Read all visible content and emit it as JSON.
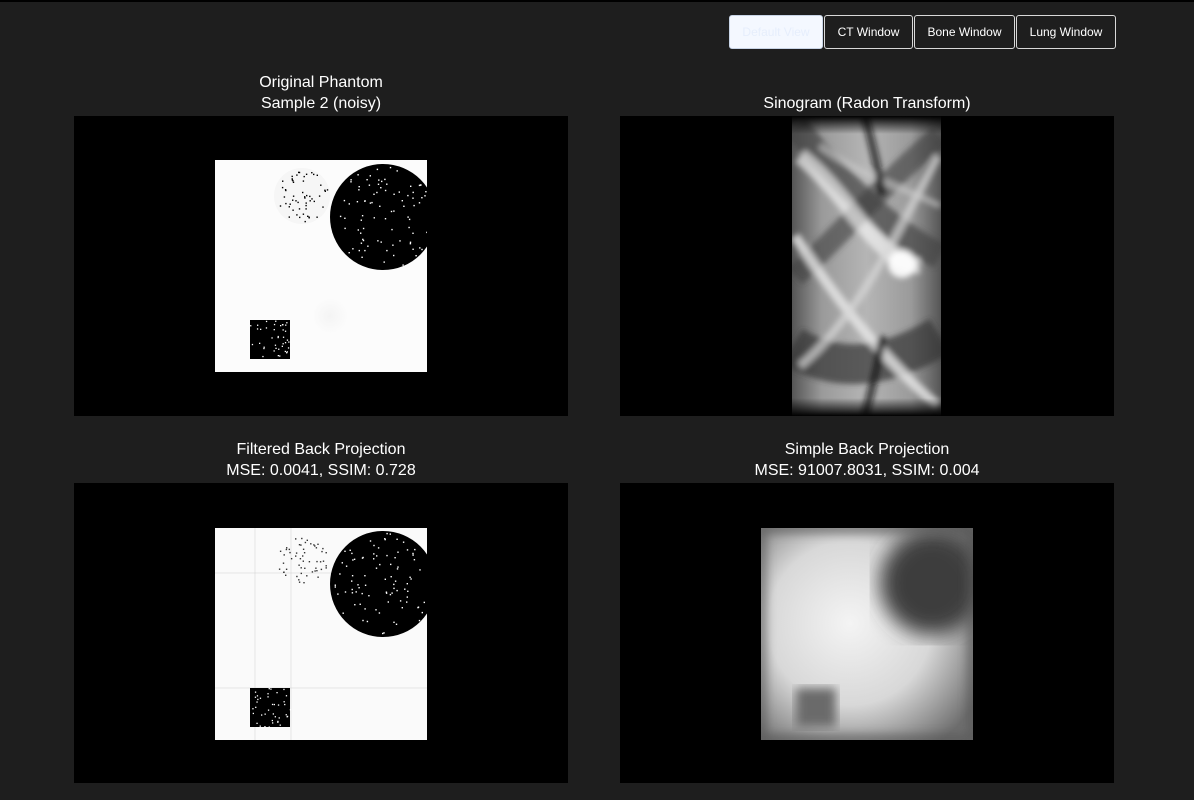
{
  "toolbar": {
    "buttons": [
      {
        "label": "Default View",
        "active": true
      },
      {
        "label": "CT Window",
        "active": false
      },
      {
        "label": "Bone Window",
        "active": false
      },
      {
        "label": "Lung Window",
        "active": false
      }
    ]
  },
  "panels": {
    "original": {
      "title": "Original Phantom",
      "subtitle": "Sample 2 (noisy)"
    },
    "sinogram": {
      "title": "Sinogram (Radon Transform)"
    },
    "fbp": {
      "title": "Filtered Back Projection",
      "subtitle": "MSE: 0.0041, SSIM: 0.728"
    },
    "sbp": {
      "title": "Simple Back Projection",
      "subtitle": "MSE: 91007.8031, SSIM: 0.004"
    }
  },
  "colors": {
    "background": "#1e1e1e",
    "panel": "#000000",
    "text": "#ffffff"
  }
}
